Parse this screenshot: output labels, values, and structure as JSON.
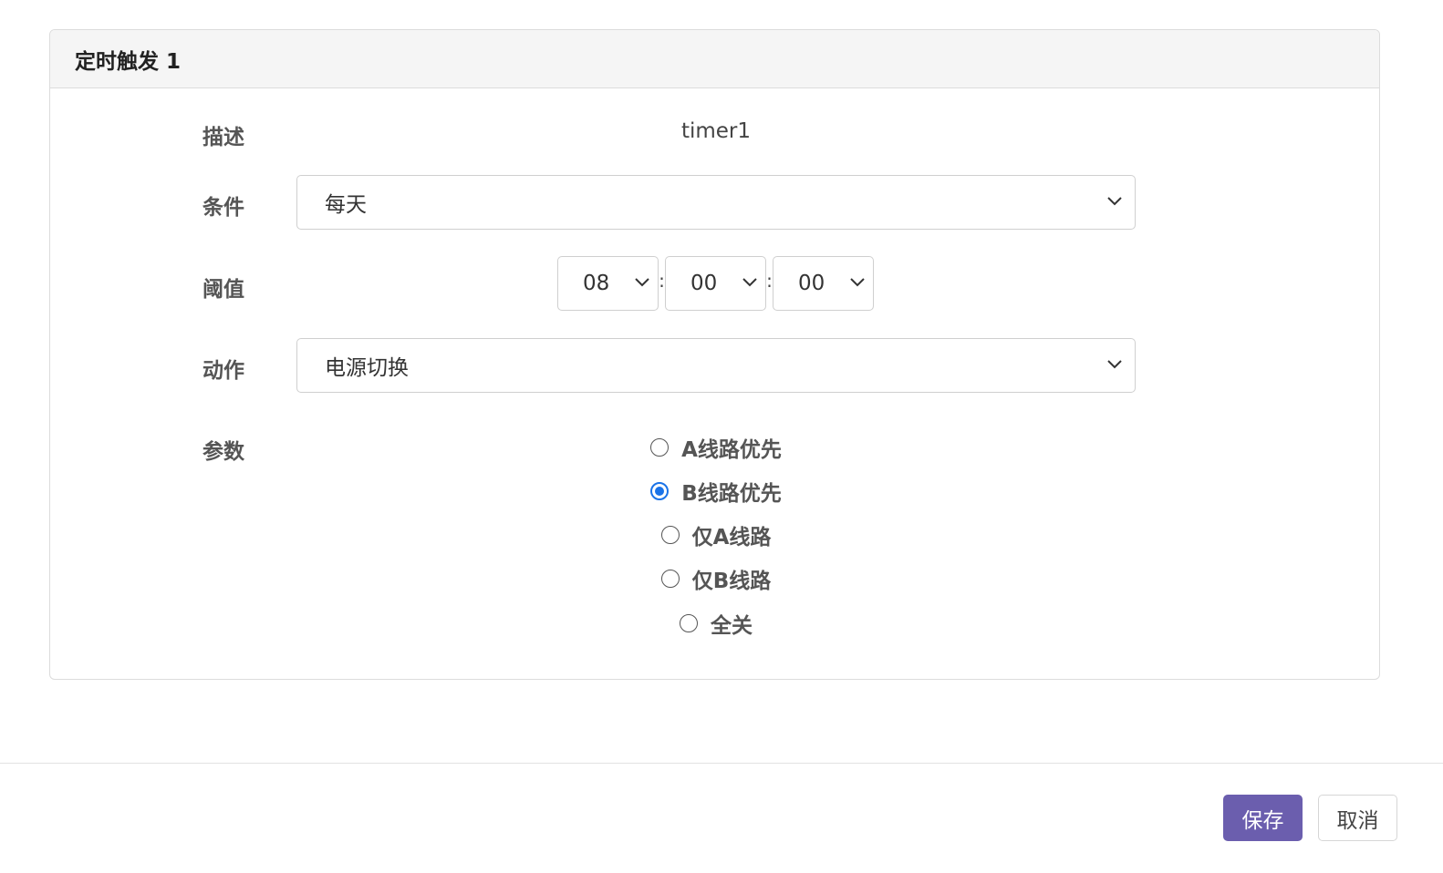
{
  "card": {
    "title": "定时触发 1"
  },
  "form": {
    "description": {
      "label": "描述",
      "value": "timer1"
    },
    "condition": {
      "label": "条件",
      "value": "每天"
    },
    "threshold": {
      "label": "阈值",
      "hour": "08",
      "minute": "00",
      "second": "00",
      "separator": ":"
    },
    "action": {
      "label": "动作",
      "value": "电源切换"
    },
    "params": {
      "label": "参数",
      "options": [
        {
          "label": "A线路优先",
          "checked": false
        },
        {
          "label": "B线路优先",
          "checked": true
        },
        {
          "label": "仅A线路",
          "checked": false
        },
        {
          "label": "仅B线路",
          "checked": false
        },
        {
          "label": "全关",
          "checked": false
        }
      ]
    }
  },
  "footer": {
    "save_label": "保存",
    "cancel_label": "取消"
  },
  "colors": {
    "primary_button": "#6b5eae",
    "radio_checked": "#1a73e8"
  },
  "icons": {
    "select_arrow": "chevron-down-icon"
  }
}
